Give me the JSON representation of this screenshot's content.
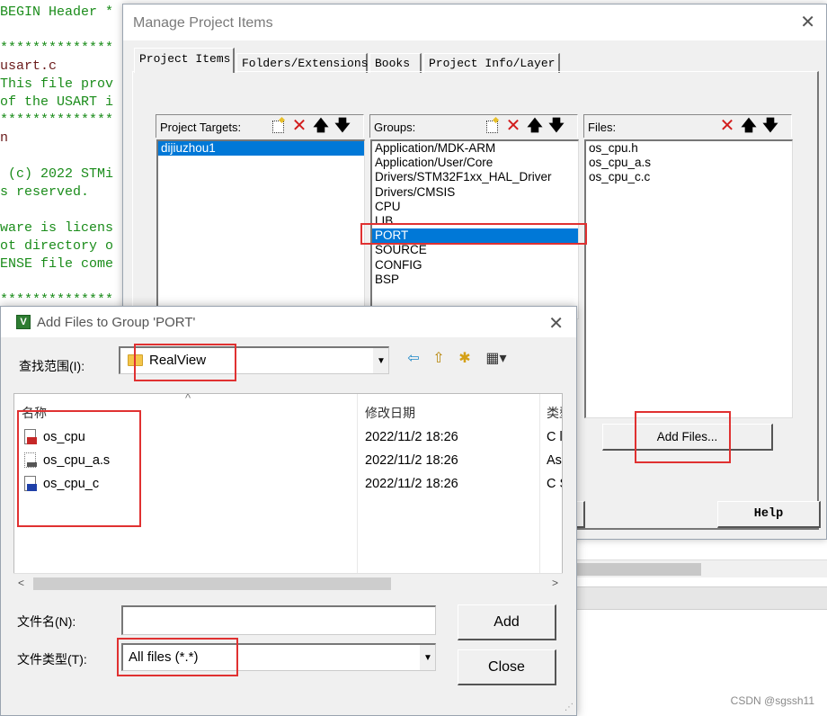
{
  "editor": {
    "lines": [
      "BEGIN Header *",
      "",
      "**************",
      "usart.c",
      "This file prov",
      "of the USART i",
      "**************",
      "n",
      "",
      " (c) 2022 STMi",
      "s reserved.",
      "",
      "ware is licens",
      "ot directory o",
      "ENSE file come",
      "",
      "**************"
    ]
  },
  "manage_dialog": {
    "title": "Manage Project Items",
    "close_glyph": "✕",
    "tabs": [
      "Project Items",
      "Folders/Extensions",
      "Books",
      "Project Info/Layer"
    ],
    "targets": {
      "label": "Project Targets:",
      "items": [
        "dijiuzhou1"
      ],
      "selected_index": 0
    },
    "groups": {
      "label": "Groups:",
      "items": [
        "Application/MDK-ARM",
        "Application/User/Core",
        "Drivers/STM32F1xx_HAL_Driver",
        "Drivers/CMSIS",
        "CPU",
        "LIB",
        "PORT",
        "SOURCE",
        "CONFIG",
        "BSP"
      ],
      "selected_index": 6
    },
    "files": {
      "label": "Files:",
      "items": [
        "os_cpu.h",
        "os_cpu_a.s",
        "os_cpu_c.c"
      ]
    },
    "toolbar_glyphs": {
      "new": "",
      "delete": "✕",
      "up": "🡅",
      "down": "🡇"
    },
    "add_files_label": "Add Files...",
    "help_label": "Help"
  },
  "add_dialog": {
    "title": "Add Files to Group 'PORT'",
    "app_icon_letter": "V",
    "close_glyph": "✕",
    "look_in_label": "查找范围(I):",
    "look_in_value": "RealView",
    "nav_icons": {
      "back": "⇦",
      "up_folder": "⇧",
      "new_folder": "✱",
      "view_menu": "▦▾"
    },
    "sort_glyph": "^",
    "columns": [
      "名称",
      "修改日期",
      "类型"
    ],
    "files": [
      {
        "name": "os_cpu",
        "date": "2022/11/2 18:26",
        "type": "C l",
        "icon": "c-header-file-icon"
      },
      {
        "name": "os_cpu_a.s",
        "date": "2022/11/2 18:26",
        "type": "As",
        "icon": "asm-file-icon"
      },
      {
        "name": "os_cpu_c",
        "date": "2022/11/2 18:26",
        "type": "C S",
        "icon": "c-source-file-icon"
      }
    ],
    "filename_label": "文件名(N):",
    "filename_value": "",
    "filetype_label": "文件类型(T):",
    "filetype_value": "All files (*.*)",
    "add_label": "Add",
    "close_label": "Close"
  },
  "watermark": "CSDN @sgssh11",
  "colors": {
    "highlight": "#e03131",
    "selection": "#0078d7",
    "code_green": "#1a8c1a"
  }
}
